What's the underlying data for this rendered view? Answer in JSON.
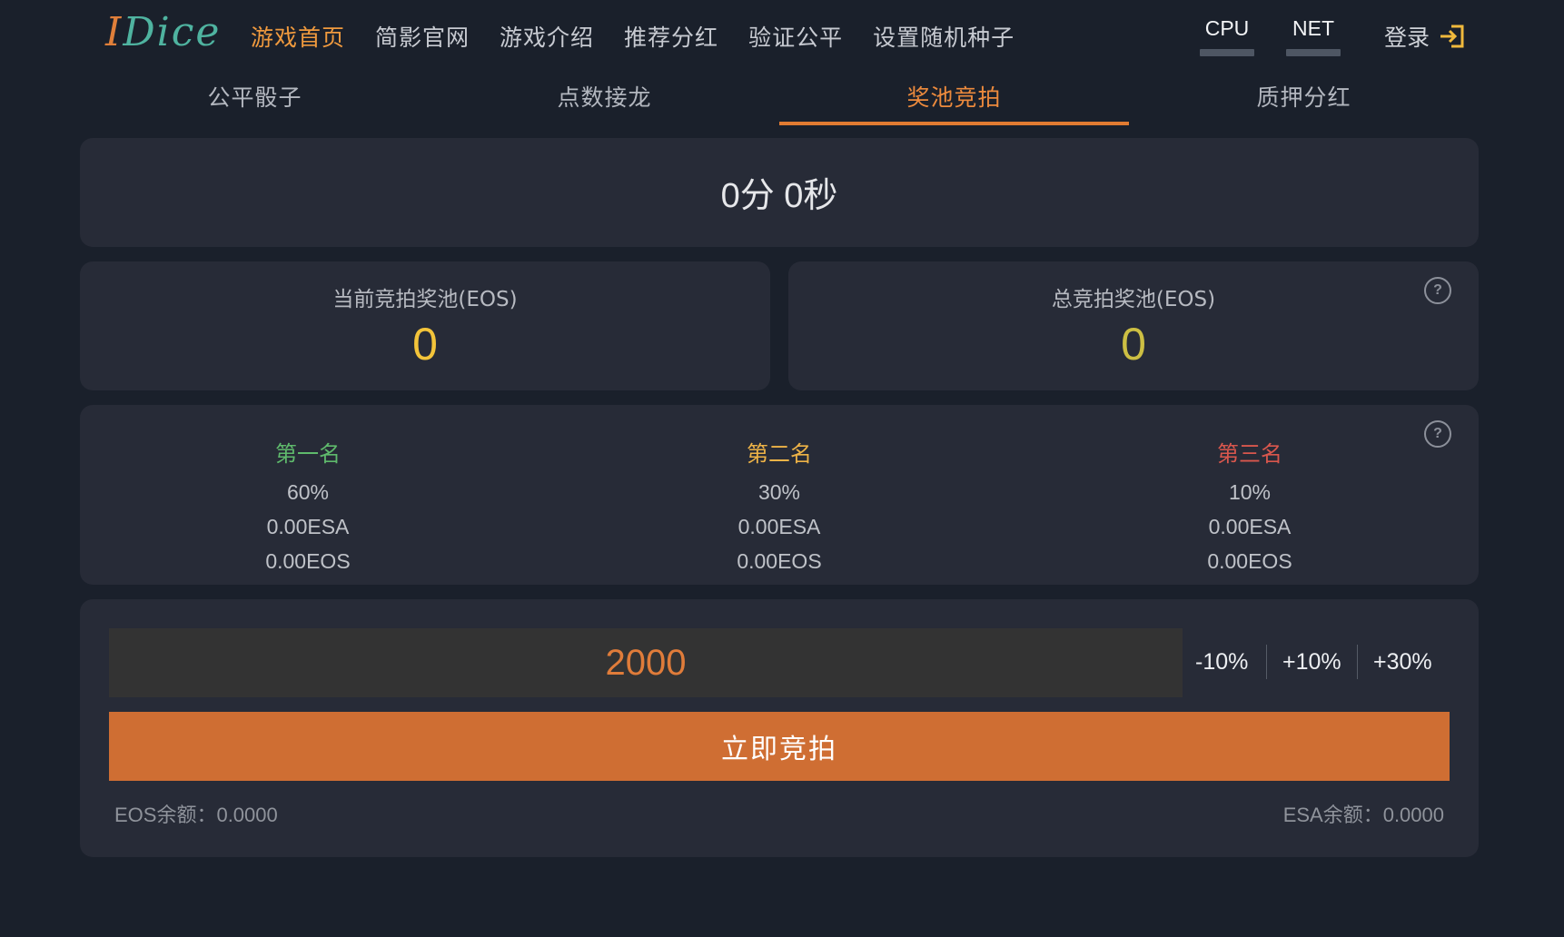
{
  "logo": {
    "part1": "I",
    "part2": "Dice"
  },
  "nav": [
    {
      "label": "游戏首页",
      "active": true
    },
    {
      "label": "简影官网",
      "active": false
    },
    {
      "label": "游戏介绍",
      "active": false
    },
    {
      "label": "推荐分红",
      "active": false
    },
    {
      "label": "验证公平",
      "active": false
    },
    {
      "label": "设置随机种子",
      "active": false
    }
  ],
  "resources": {
    "cpu": {
      "label": "CPU",
      "usage_fraction": 0.0
    },
    "net": {
      "label": "NET",
      "usage_fraction": 0.0
    }
  },
  "login": {
    "label": "登录",
    "icon": "login-icon"
  },
  "tabs": [
    {
      "label": "公平骰子",
      "active": false
    },
    {
      "label": "点数接龙",
      "active": false
    },
    {
      "label": "奖池竞拍",
      "active": true
    },
    {
      "label": "质押分红",
      "active": false
    }
  ],
  "timer": {
    "text": "0分 0秒"
  },
  "pools": {
    "current": {
      "title": "当前竞拍奖池(EOS)",
      "value": "0"
    },
    "total": {
      "title": "总竞拍奖池(EOS)",
      "value": "0",
      "help": "?"
    }
  },
  "ranks": {
    "help": "?",
    "items": [
      {
        "name": "第一名",
        "percent": "60%",
        "esa": "0.00ESA",
        "eos": "0.00EOS",
        "color": "#5fba6c"
      },
      {
        "name": "第二名",
        "percent": "30%",
        "esa": "0.00ESA",
        "eos": "0.00EOS",
        "color": "#eeb347"
      },
      {
        "name": "第三名",
        "percent": "10%",
        "esa": "0.00ESA",
        "eos": "0.00EOS",
        "color": "#d9574d"
      }
    ]
  },
  "bid": {
    "amount": "2000",
    "adjust": [
      "-10%",
      "+10%",
      "+30%"
    ],
    "submit_label": "立即竞拍",
    "eos_balance": "EOS余额：0.0000",
    "esa_balance": "ESA余额：0.0000"
  },
  "colors": {
    "accent": "#e17b32",
    "background": "#1a202b",
    "card": "#272b37"
  }
}
